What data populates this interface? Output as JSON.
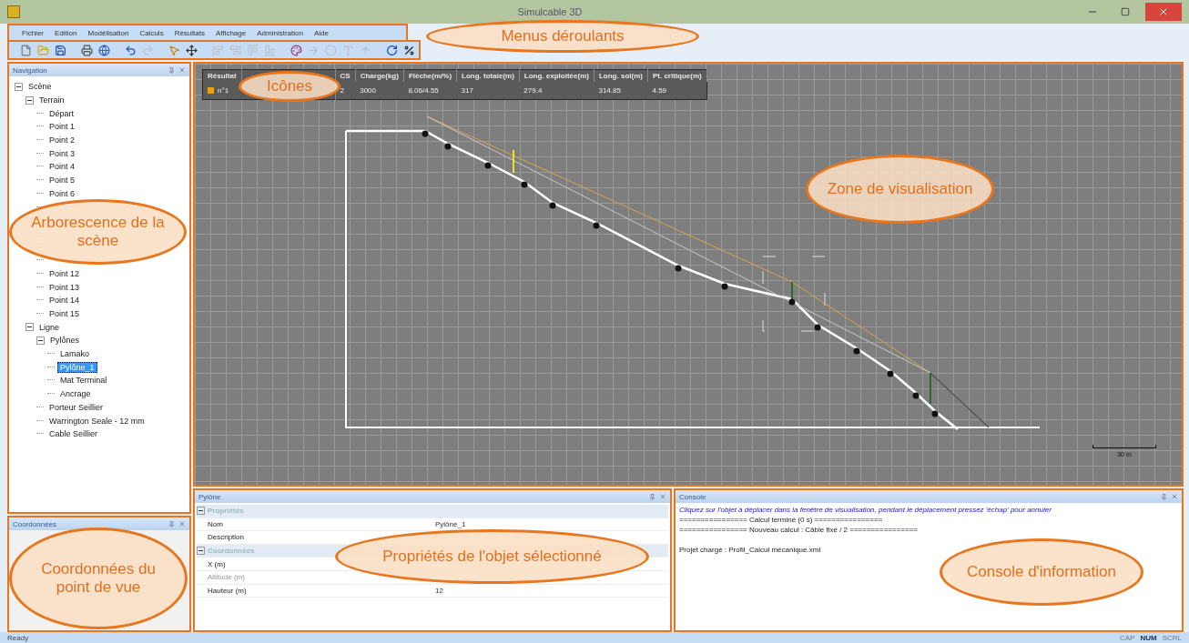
{
  "window": {
    "title": "Simulcable 3D"
  },
  "menu": [
    "Fichier",
    "Edition",
    "Modélisation",
    "Calculs",
    "Résultats",
    "Affichage",
    "Administration",
    "Aide"
  ],
  "toolbar": [
    {
      "disabled": false
    },
    {
      "disabled": false
    },
    {
      "disabled": false
    },
    {
      "disabled": false
    },
    {
      "disabled": false
    },
    {
      "disabled": false
    },
    {
      "disabled": true
    },
    {
      "disabled": false
    },
    {
      "disabled": false
    },
    {
      "disabled": true
    },
    {
      "disabled": true
    },
    {
      "disabled": true
    },
    {
      "disabled": true
    },
    {
      "disabled": false
    },
    {
      "disabled": true
    },
    {
      "disabled": true
    },
    {
      "disabled": true
    },
    {
      "disabled": true
    },
    {
      "disabled": false
    },
    {
      "disabled": false
    }
  ],
  "navigation": {
    "title": "Navigation",
    "tree": [
      {
        "label": "Scène",
        "expanded": true,
        "selected": false,
        "children": [
          {
            "label": "Terrain",
            "expanded": true,
            "selected": false,
            "children": [
              {
                "label": "Départ",
                "selected": false
              },
              {
                "label": "Point 1",
                "selected": false
              },
              {
                "label": "Point 2",
                "selected": false
              },
              {
                "label": "Point 3",
                "selected": false
              },
              {
                "label": "Point 4",
                "selected": false
              },
              {
                "label": "Point 5",
                "selected": false
              },
              {
                "label": "Point 6",
                "selected": false
              },
              {
                "selected": false
              },
              {
                "selected": false
              },
              {
                "selected": false
              },
              {
                "selected": false
              },
              {
                "selected": false
              },
              {
                "label": "Point 12",
                "selected": false
              },
              {
                "label": "Point 13",
                "selected": false
              },
              {
                "label": "Point 14",
                "selected": false
              },
              {
                "label": "Point 15",
                "selected": false
              }
            ]
          },
          {
            "label": "Ligne",
            "expanded": true,
            "selected": false,
            "children": [
              {
                "label": "Pylônes",
                "expanded": true,
                "selected": false,
                "children": [
                  {
                    "label": "Lamako",
                    "selected": false
                  },
                  {
                    "label": "Pylône_1",
                    "selected": true
                  },
                  {
                    "label": "Mat Terminal",
                    "selected": false
                  },
                  {
                    "label": "Ancrage",
                    "selected": false
                  }
                ]
              },
              {
                "label": "Porteur Seillier",
                "selected": false
              },
              {
                "label": "Warrington Seale - 12 mm",
                "selected": false
              },
              {
                "label": "Cable Seillier",
                "selected": false
              }
            ]
          }
        ]
      }
    ]
  },
  "results_table": {
    "columns": [
      "Résultat",
      "CS",
      "Charge(kg)",
      "Flèche(m/%)",
      "Long. totale(m)",
      "Long. exploitée(m)",
      "Long. sol(m)",
      "Pt. critique(m)"
    ],
    "rows": [
      {
        "color": "#f0a000",
        "cells": [
          "n°1",
          "2",
          "3000",
          "8.06/4.55",
          "317",
          "279.4",
          "314.85",
          "4.59"
        ]
      }
    ]
  },
  "viewport": {
    "scale_label": "30 m"
  },
  "coordinates": {
    "title": "Coordonnées"
  },
  "properties": {
    "title": "Pylône",
    "rows": [
      {
        "kind": "group",
        "label": "Propriétés",
        "expanded": true
      },
      {
        "kind": "property",
        "label": "Nom",
        "value": "Pylône_1",
        "disabled": false
      },
      {
        "kind": "property",
        "label": "Description",
        "disabled": false
      },
      {
        "kind": "group",
        "label": "Coordonnées",
        "expanded": true
      },
      {
        "kind": "property",
        "label": "X (m)",
        "disabled": false
      },
      {
        "kind": "property",
        "label": "Altitude (m)",
        "disabled": true
      },
      {
        "kind": "property",
        "label": "Hauteur (m)",
        "value": "12",
        "disabled": false
      }
    ]
  },
  "console": {
    "title": "Console",
    "lines": [
      {
        "kind": "info",
        "text": "Cliquez sur l'objet à déplacer dans la fenêtre de visualisation, pendant le déplacement pressez 'échap' pour annuler"
      },
      {
        "kind": "log",
        "text": "================ Calcul terminé (0 s) ================"
      },
      {
        "kind": "log",
        "text": "================ Nouveau calcul : Câble fixe / 2 ================"
      },
      {
        "kind": "blank"
      },
      {
        "kind": "log",
        "text": "Projet chargé : Profil_Calcul mécanique.xml"
      }
    ]
  },
  "status_bar": {
    "text": "Ready",
    "indicators": [
      {
        "label": "CAP",
        "on": false
      },
      {
        "label": "NUM",
        "on": true
      },
      {
        "label": "SCRL",
        "on": false
      }
    ]
  },
  "annotations": [
    {
      "text": "Menus déroulants"
    },
    {
      "text": "Icônes"
    },
    {
      "text": "Zone de visualisation"
    },
    {
      "text": "Arborescence de la scène"
    },
    {
      "text": "Coordonnées du point de vue"
    },
    {
      "text": "Propriétés de l'objet sélectionné"
    },
    {
      "text": "Console d'information"
    }
  ]
}
